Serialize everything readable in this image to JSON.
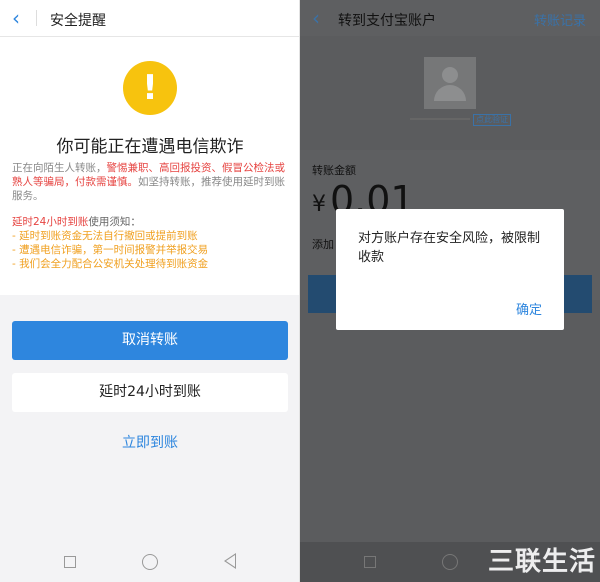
{
  "left": {
    "nav_title": "安全提醒",
    "heading": "你可能正在遭遇电信欺诈",
    "para_intro": "正在向陌生人转账，",
    "para_red": "警惕兼职、高回报投资、假冒公检法或熟人等骗局，付款需谨慎。",
    "para_end": "如坚持转账，推荐使用延时到账服务。",
    "notes_red": "延时24小时到账",
    "notes_head": "使用须知：",
    "notes_items": [
      "- 延时到账资金无法自行撤回或提前到账",
      "- 遭遇电信诈骗，第一时间报警并举报交易",
      "- 我们会全力配合公安机关处理待到账资金"
    ],
    "btn_cancel": "取消转账",
    "btn_delay": "延时24小时到账",
    "btn_now": "立即到账"
  },
  "right": {
    "nav_title": "转到支付宝账户",
    "nav_link": "转账记录",
    "verify_tag": "点此验证",
    "amount_label": "转账金额",
    "currency": "¥",
    "amount": "0.01",
    "add_note": "添加",
    "modal_message": "对方账户存在安全风险，被限制收款",
    "modal_ok": "确定"
  },
  "watermark": "三联生活"
}
